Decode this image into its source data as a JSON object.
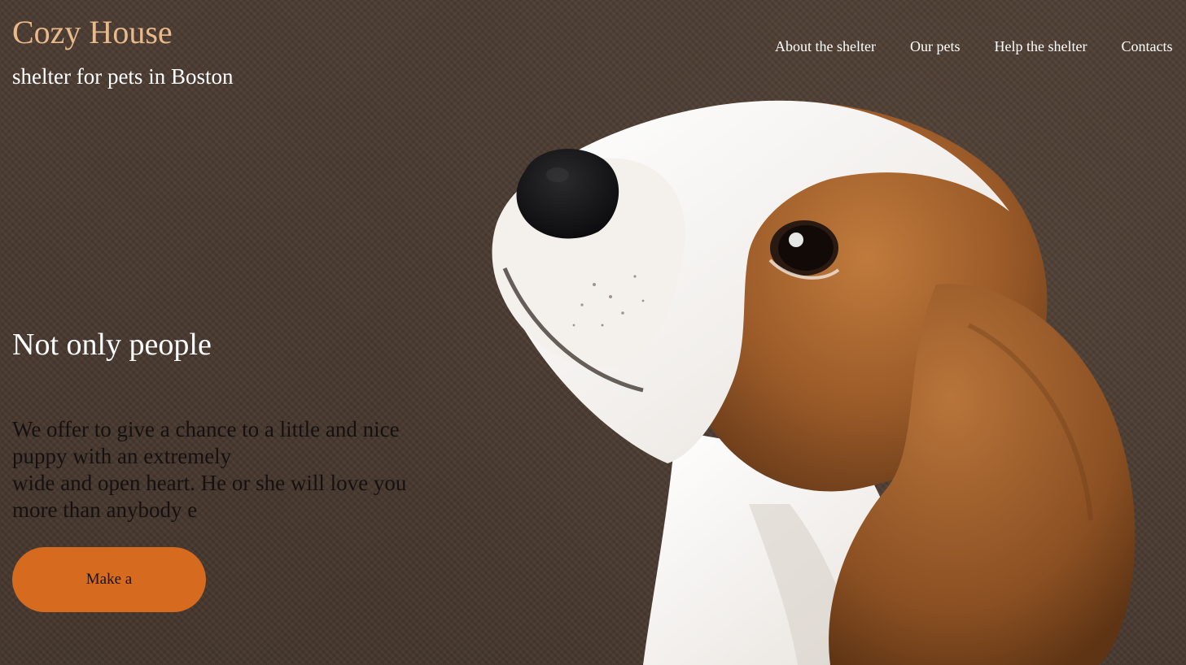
{
  "header": {
    "logo": "Cozy House",
    "tagline": "shelter for pets in Boston"
  },
  "nav": {
    "items": [
      "About the shelter",
      "Our pets",
      "Help the shelter",
      "Contacts"
    ]
  },
  "hero": {
    "title": "Not only people",
    "text_lines": [
      "We offer to give a chance to a little and nice",
      "puppy with an extremely",
      "wide and open heart. He or she will love you",
      "more than anybody e"
    ],
    "button_label": "Make a"
  },
  "colors": {
    "background": "#4a3a30",
    "logo": "#e8b98a",
    "accent": "#d66b1f"
  },
  "image": {
    "name": "beagle-puppy-photo"
  }
}
